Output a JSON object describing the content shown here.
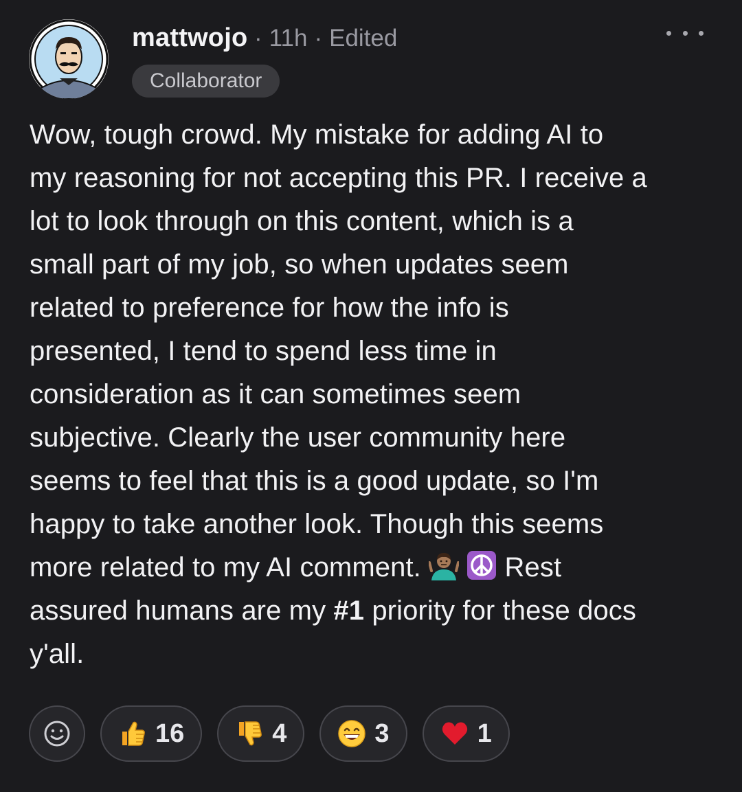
{
  "header": {
    "username": "mattwojo",
    "separator": "·",
    "time": "11h",
    "edited": "Edited",
    "badge": "Collaborator",
    "more_icon": "ellipsis-icon"
  },
  "body": {
    "lines": [
      "Wow, tough crowd. My mistake for adding AI to",
      "my reasoning for not accepting this PR. I receive a",
      "lot to look through on this content, which is a",
      "small part of my job, so when updates seem",
      "related to preference for how the info is",
      "presented, I tend to spend less time in",
      "consideration as it can sometimes seem",
      "subjective. Clearly the user community here",
      "seems to feel that this is a good update, so I'm",
      "happy to take another look. Though this seems"
    ],
    "line11_before": "more related to my AI comment. ",
    "line11_after": " Rest",
    "line12_before": "assured humans are my ",
    "line12_bold": "#1",
    "line12_after": " priority for these docs",
    "line13": "y'all.",
    "emoji_shrug": "person-shrugging-emoji",
    "emoji_peace": "peace-symbol-emoji"
  },
  "reactions": {
    "add_icon": "smiley-add-reaction-icon",
    "items": [
      {
        "icon": "thumbs-up-emoji",
        "count": "16"
      },
      {
        "icon": "thumbs-down-emoji",
        "count": "4"
      },
      {
        "icon": "grinning-face-emoji",
        "count": "3"
      },
      {
        "icon": "red-heart-emoji",
        "count": "1"
      }
    ]
  },
  "colors": {
    "background": "#1b1b1e",
    "text": "#f2f2f4",
    "muted": "#9a9aa2",
    "badge_bg": "#3a3a3e",
    "pill_border": "#47474d"
  }
}
